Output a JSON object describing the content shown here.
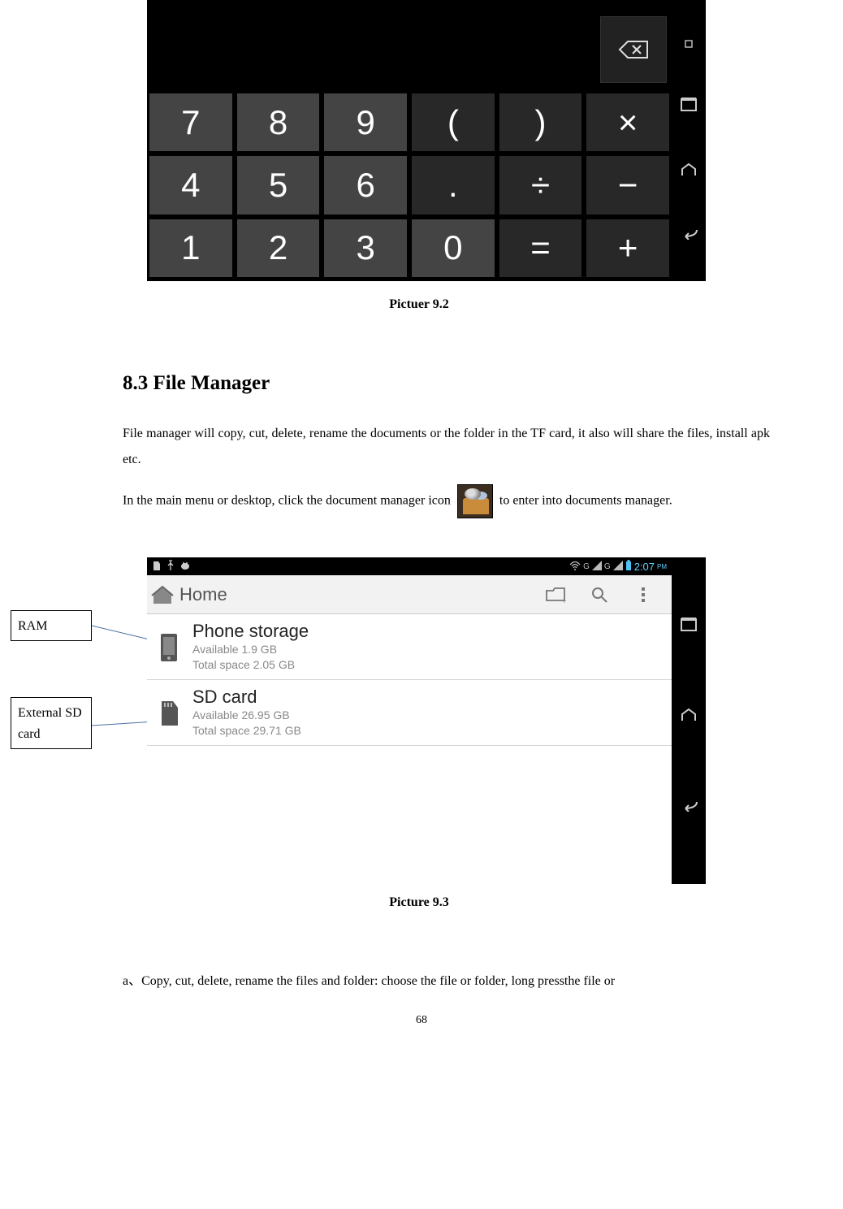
{
  "calc": {
    "keys": [
      {
        "label": "7",
        "type": "num"
      },
      {
        "label": "8",
        "type": "num"
      },
      {
        "label": "9",
        "type": "num"
      },
      {
        "label": "(",
        "type": "op"
      },
      {
        "label": ")",
        "type": "op"
      },
      {
        "label": "×",
        "type": "op"
      },
      {
        "label": "4",
        "type": "num"
      },
      {
        "label": "5",
        "type": "num"
      },
      {
        "label": "6",
        "type": "num"
      },
      {
        "label": ".",
        "type": "op"
      },
      {
        "label": "÷",
        "type": "op"
      },
      {
        "label": "−",
        "type": "op"
      },
      {
        "label": "1",
        "type": "num"
      },
      {
        "label": "2",
        "type": "num"
      },
      {
        "label": "3",
        "type": "num"
      },
      {
        "label": "0",
        "type": "num"
      },
      {
        "label": "=",
        "type": "op"
      },
      {
        "label": "+",
        "type": "op"
      }
    ]
  },
  "captions": {
    "c1": "Pictuer 9.2",
    "c2": "Picture 9.3"
  },
  "section": {
    "title": "8.3 File Manager",
    "para1": "File manager will copy, cut, delete, rename the documents or the folder in the TF card, it also will share the files, install apk etc.",
    "para2a": "In the main menu or desktop, click the document manager icon ",
    "para2b": " to enter into documents manager.",
    "para3": "a、Copy, cut, delete, rename the files and folder: choose the file or folder, long pressthe file or"
  },
  "annotations": {
    "ram": "RAM",
    "sd": "External SD card"
  },
  "fm": {
    "status_time": "2:07",
    "status_ampm": "PM",
    "home": "Home",
    "items": [
      {
        "title": "Phone storage",
        "avail": "Available 1.9 GB",
        "total": "Total space 2.05 GB"
      },
      {
        "title": "SD card",
        "avail": "Available 26.95 GB",
        "total": "Total space 29.71 GB"
      }
    ],
    "status_g1": "G",
    "status_g2": "G"
  },
  "page_num": "68"
}
